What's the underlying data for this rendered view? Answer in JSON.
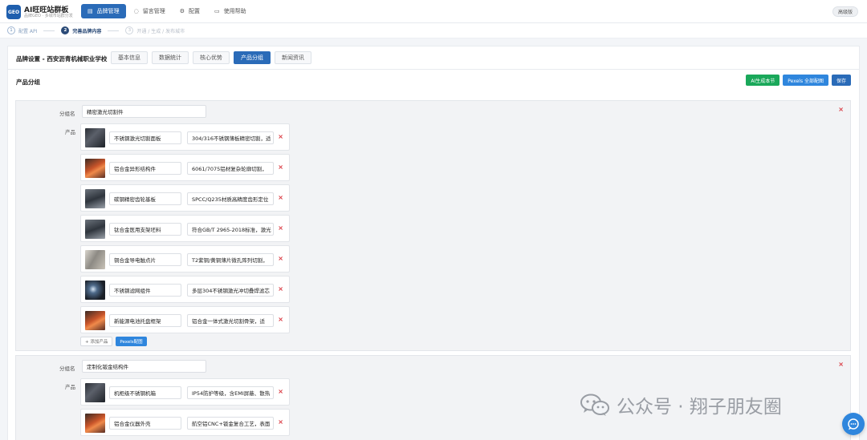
{
  "app": {
    "logo": "GEO",
    "title": "AI旺旺站群板",
    "subtitle": "品牌GEO · 多城市站群分发",
    "edition": "高级版"
  },
  "nav": {
    "items": [
      {
        "label": "品牌管理",
        "icon": "chart-icon",
        "active": true
      },
      {
        "label": "留言管理",
        "icon": "message-icon",
        "active": false
      },
      {
        "label": "配置",
        "icon": "gear-icon",
        "active": false
      },
      {
        "label": "使用帮助",
        "icon": "book-icon",
        "active": false
      }
    ]
  },
  "steps": [
    {
      "num": "1",
      "label": "配置 API",
      "state": "done"
    },
    {
      "num": "2",
      "label": "完善品牌内容",
      "state": "current"
    },
    {
      "num": "3",
      "label": "开通 / 生成 / 发布城市",
      "state": "disabled"
    }
  ],
  "brand": {
    "heading": "品牌设置 - 西安沥青机械职业学校",
    "tabs": [
      "基本信息",
      "数据统计",
      "核心优势",
      "产品分组",
      "新闻资讯"
    ],
    "active_tab": "产品分组"
  },
  "section": {
    "title": "产品分组",
    "buttons": {
      "ai_generate": "AI生成本节",
      "pexels_all": "Pexels 全部配图",
      "save": "保存"
    }
  },
  "labels": {
    "group_name": "分组名",
    "products": "产品",
    "add_product": "+ 添加产品",
    "pexels": "Pexels配图",
    "delete": "×"
  },
  "groups": [
    {
      "name": "精密激光切割件",
      "products": [
        {
          "name": "不锈钢激光切割面板",
          "desc": "304/316不锈钢薄板精密切割，适",
          "thumb": "workshop-dark"
        },
        {
          "name": "铝合金异形结构件",
          "desc": "6061/7075铝材复杂轮廓切割，",
          "thumb": "laser-orange"
        },
        {
          "name": "碳钢精密齿轮基板",
          "desc": "SPCC/Q235材质高精度齿形定位",
          "thumb": "factory-grey"
        },
        {
          "name": "钛合金医用支架坯料",
          "desc": "符合GB/T 2965-2018标准，激光",
          "thumb": "factory-grey"
        },
        {
          "name": "铜合金导电触点片",
          "desc": "T2紫铜/黄铜薄片微孔阵列切割，",
          "thumb": "room-light"
        },
        {
          "name": "不锈钢滤网组件",
          "desc": "多层304不锈钢激光冲切叠焊滤芯",
          "thumb": "welding-dark"
        },
        {
          "name": "新能源电池托盘框架",
          "desc": "铝合金一体式激光切割骨架，适",
          "thumb": "laser-orange"
        }
      ]
    },
    {
      "name": "定制化钣金结构件",
      "products": [
        {
          "name": "机柜级不锈钢机箱",
          "desc": "IP54防护等级，含EMI屏蔽、散热",
          "thumb": "workshop-dark"
        },
        {
          "name": "铝合金仪器外壳",
          "desc": "航空铝CNC+钣金复合工艺，表面",
          "thumb": "laser-orange"
        }
      ]
    }
  ],
  "watermark": {
    "text": "公众号 · 翔子朋友圈"
  },
  "colors": {
    "primary": "#2a6bb8",
    "accent_blue": "#2f86dd",
    "success_green": "#1aa85a",
    "danger_red": "#d9363e"
  }
}
